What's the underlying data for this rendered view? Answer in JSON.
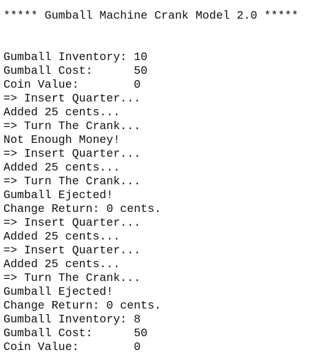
{
  "console": {
    "lines": [
      "***** Gumball Machine Crank Model 2.0 *****",
      "",
      "",
      "Gumball Inventory: 10",
      "Gumball Cost:      50",
      "Coin Value:        0",
      "=> Insert Quarter...",
      "Added 25 cents...",
      "=> Turn The Crank...",
      "Not Enough Money!",
      "=> Insert Quarter...",
      "Added 25 cents...",
      "=> Turn The Crank...",
      "Gumball Ejected!",
      "Change Return: 0 cents.",
      "=> Insert Quarter...",
      "Added 25 cents...",
      "=> Insert Quarter...",
      "Added 25 cents...",
      "=> Turn The Crank...",
      "Gumball Ejected!",
      "Change Return: 0 cents.",
      "Gumball Inventory: 8",
      "Gumball Cost:      50",
      "Coin Value:        0"
    ]
  }
}
